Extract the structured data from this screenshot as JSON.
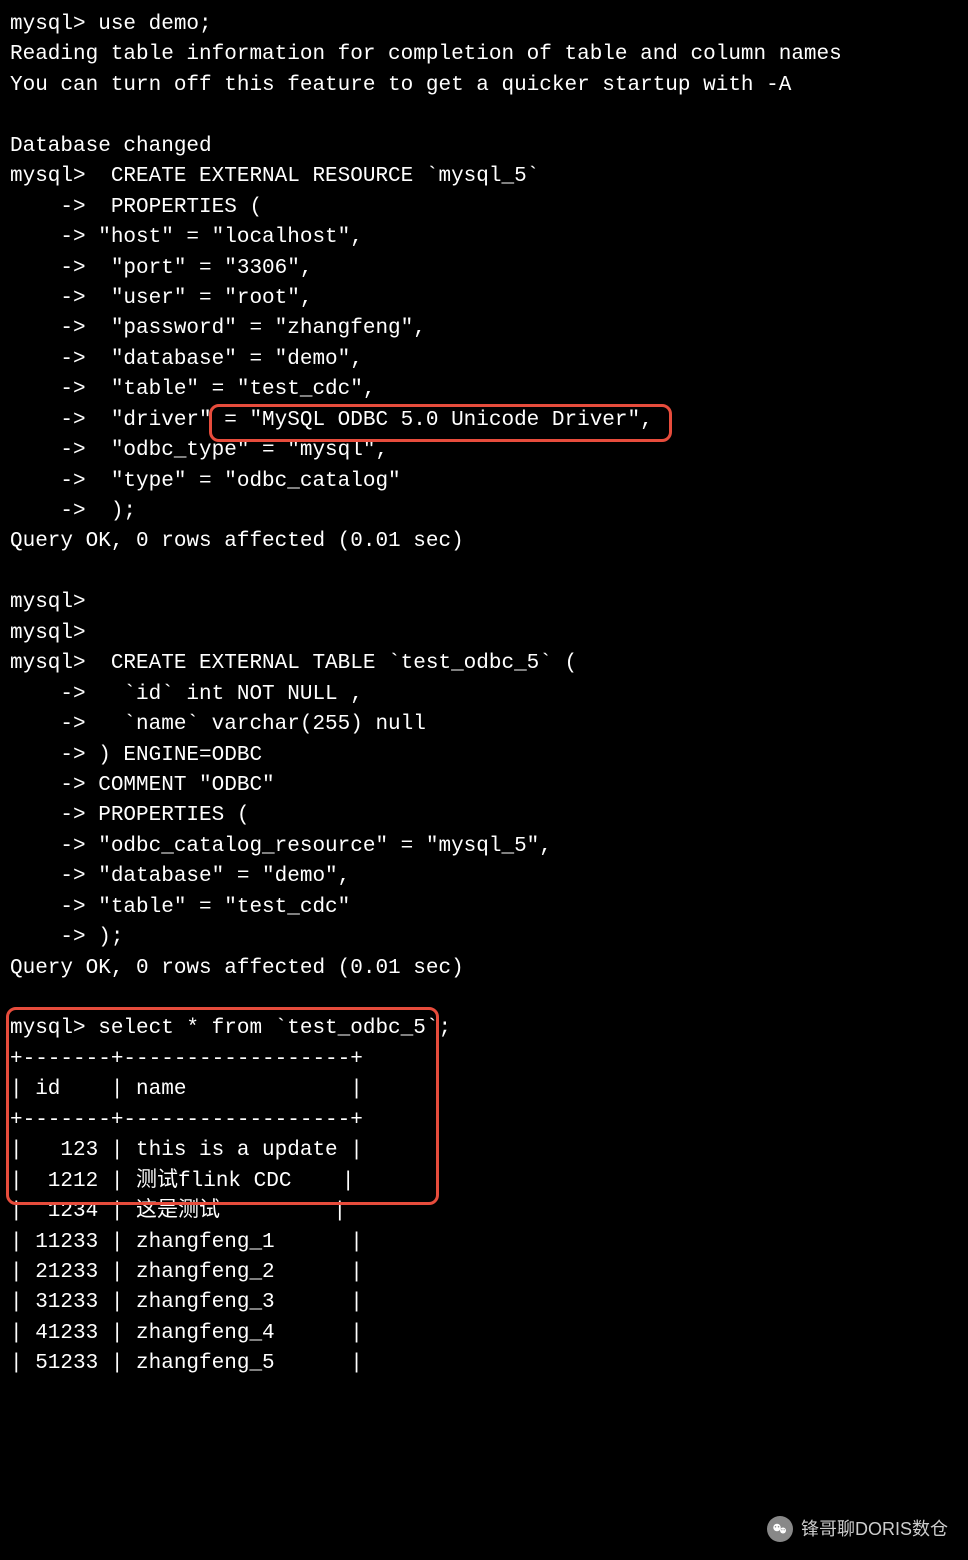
{
  "terminal": {
    "lines": [
      "mysql> use demo;",
      "Reading table information for completion of table and column names",
      "You can turn off this feature to get a quicker startup with -A",
      "",
      "Database changed",
      "mysql>  CREATE EXTERNAL RESOURCE `mysql_5`",
      "    ->  PROPERTIES (",
      "    -> \"host\" = \"localhost\",",
      "    ->  \"port\" = \"3306\",",
      "    ->  \"user\" = \"root\",",
      "    ->  \"password\" = \"zhangfeng\",",
      "    ->  \"database\" = \"demo\",",
      "    ->  \"table\" = \"test_cdc\",",
      "    ->  \"driver\" = \"MySQL ODBC 5.0 Unicode Driver\",",
      "    ->  \"odbc_type\" = \"mysql\",",
      "    ->  \"type\" = \"odbc_catalog\"",
      "    ->  );",
      "Query OK, 0 rows affected (0.01 sec)",
      "",
      "mysql>",
      "mysql>",
      "mysql>  CREATE EXTERNAL TABLE `test_odbc_5` (",
      "    ->   `id` int NOT NULL ,",
      "    ->   `name` varchar(255) null",
      "    -> ) ENGINE=ODBC",
      "    -> COMMENT \"ODBC\"",
      "    -> PROPERTIES (",
      "    -> \"odbc_catalog_resource\" = \"mysql_5\",",
      "    -> \"database\" = \"demo\",",
      "    -> \"table\" = \"test_cdc\"",
      "    -> );",
      "Query OK, 0 rows affected (0.01 sec)",
      "",
      "mysql> select * from `test_odbc_5`;",
      "+-------+------------------+",
      "| id    | name             |",
      "+-------+------------------+",
      "|   123 | this is a update |",
      "|  1212 | 测试flink CDC    |",
      "|  1234 | 这是测试         |",
      "| 11233 | zhangfeng_1      |",
      "| 21233 | zhangfeng_2      |",
      "| 31233 | zhangfeng_3      |",
      "| 41233 | zhangfeng_4      |",
      "| 51233 | zhangfeng_5      |"
    ]
  },
  "table_result": {
    "columns": [
      "id",
      "name"
    ],
    "rows": [
      {
        "id": 123,
        "name": "this is a update"
      },
      {
        "id": 1212,
        "name": "测试flink CDC"
      },
      {
        "id": 1234,
        "name": "这是测试"
      },
      {
        "id": 11233,
        "name": "zhangfeng_1"
      },
      {
        "id": 21233,
        "name": "zhangfeng_2"
      },
      {
        "id": 31233,
        "name": "zhangfeng_3"
      },
      {
        "id": 41233,
        "name": "zhangfeng_4"
      },
      {
        "id": 51233,
        "name": "zhangfeng_5"
      }
    ]
  },
  "watermark": {
    "text": "锋哥聊DORIS数仓"
  },
  "highlights": {
    "driver_value": "\"MySQL ODBC 5.0 Unicode Driver\",",
    "select_query": "select * from `test_odbc_5`;"
  }
}
